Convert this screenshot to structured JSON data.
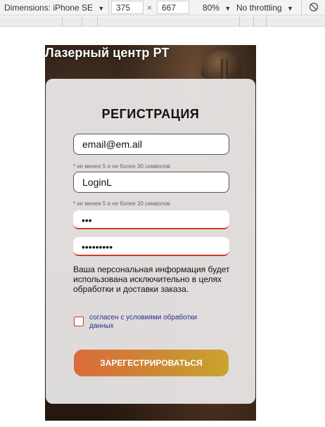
{
  "devtools": {
    "dimensions_label": "Dimensions: iPhone SE",
    "width": "375",
    "height": "667",
    "times": "×",
    "zoom": "80%",
    "throttling": "No throttling",
    "dropdown_arrow": "▼"
  },
  "site": {
    "title": "Лазерный центр РТ"
  },
  "form": {
    "title": "РЕГИСТРАЦИЯ",
    "email_value": "email@em.ail",
    "email_hint": "* не менее 5 и не более 30 символов",
    "login_value": "LoginL",
    "login_hint": "* не менее 5 и не более 30 символов",
    "password_value": "•••",
    "password_confirm_value": "•••••••••",
    "info_text": "Ваша персональная информация будет использована исключительно в целях обработки и доставки заказа.",
    "agree_label": "согласен с условиями обработки данных",
    "agree_checked": false,
    "submit_label": "ЗАРЕГЕСТРИРОВАТЬСЯ"
  },
  "colors": {
    "button_gradient_start": "#db6a3a",
    "button_gradient_end": "#c9a42e",
    "password_underline": "#d23a2a",
    "agree_text": "#2a2a8c"
  }
}
